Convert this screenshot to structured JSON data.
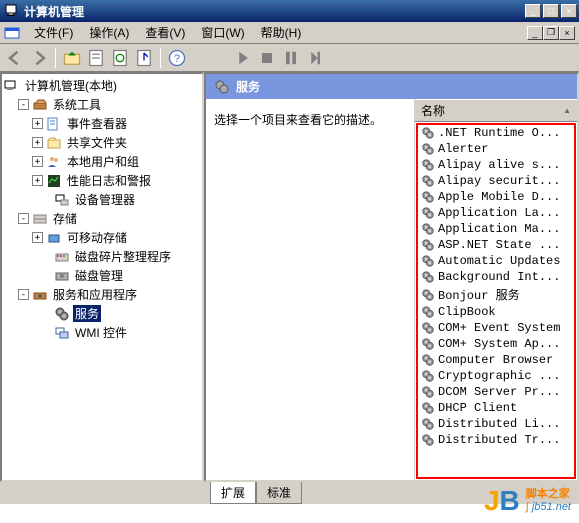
{
  "window": {
    "title": "计算机管理",
    "min_label": "_",
    "max_label": "□",
    "close_label": "×"
  },
  "menu": {
    "file": "文件(F)",
    "action": "操作(A)",
    "view": "查看(V)",
    "window": "窗口(W)",
    "help": "帮助(H)"
  },
  "tree": {
    "root": "计算机管理(本地)",
    "system_tools": "系统工具",
    "event_viewer": "事件查看器",
    "shared_folders": "共享文件夹",
    "local_users": "本地用户和组",
    "perf_logs": "性能日志和警报",
    "device_mgr": "设备管理器",
    "storage": "存储",
    "removable": "可移动存储",
    "defrag": "磁盘碎片整理程序",
    "disk_mgmt": "磁盘管理",
    "services_apps": "服务和应用程序",
    "services": "服务",
    "wmi": "WMI 控件"
  },
  "right": {
    "header": "服务",
    "desc": "选择一个项目来查看它的描述。",
    "col_name": "名称"
  },
  "services": [
    ".NET Runtime O...",
    "Alerter",
    "Alipay alive s...",
    "Alipay securit...",
    "Apple Mobile D...",
    "Application La...",
    "Application Ma...",
    "ASP.NET State ...",
    "Automatic Updates",
    "Background Int...",
    "Bonjour 服务",
    "ClipBook",
    "COM+ Event System",
    "COM+ System Ap...",
    "Computer Browser",
    "Cryptographic ...",
    "DCOM Server Pr...",
    "DHCP Client",
    "Distributed Li...",
    "Distributed Tr..."
  ],
  "tabs": {
    "extended": "扩展",
    "standard": "标准"
  },
  "watermark": {
    "name": "脚本之家",
    "url": "jb51.net"
  }
}
